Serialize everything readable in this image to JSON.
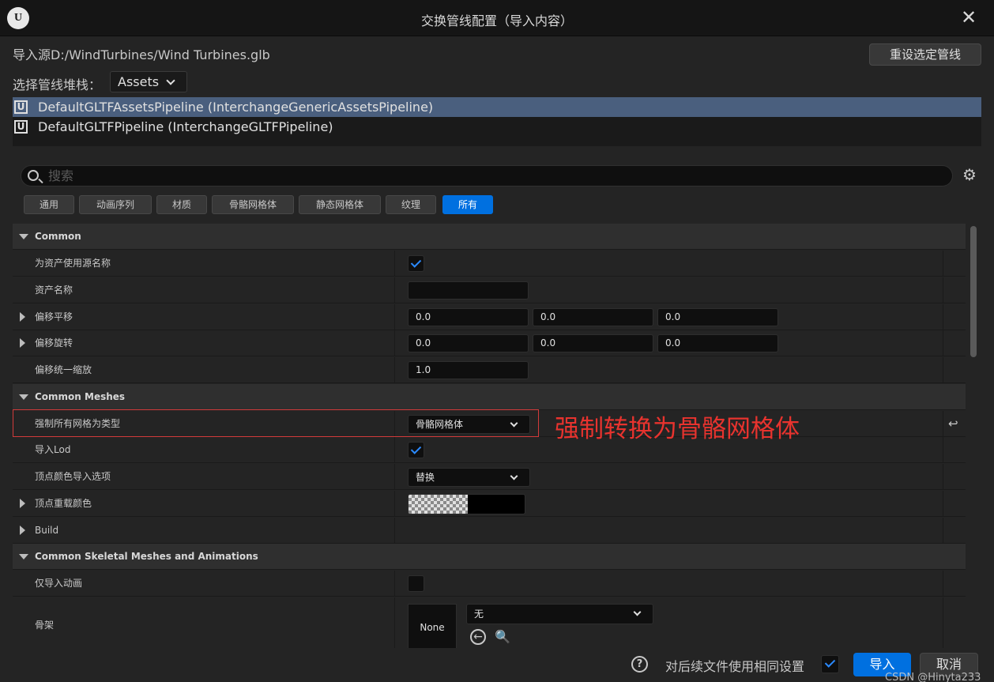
{
  "window": {
    "title": "交换管线配置（导入内容）",
    "logo_text": "U",
    "close_glyph": "✕"
  },
  "source": {
    "label": "导入源D:/WindTurbines/Wind Turbines.glb"
  },
  "reset_button": "重设选定管线",
  "stack": {
    "label": "选择管线堆栈：",
    "value": "Assets"
  },
  "pipelines": [
    {
      "label": "DefaultGLTFAssetsPipeline (InterchangeGenericAssetsPipeline)",
      "selected": true,
      "icon": "unreal-icon"
    },
    {
      "label": "DefaultGLTFPipeline (InterchangeGLTFPipeline)",
      "selected": false,
      "icon": "unreal-icon"
    }
  ],
  "search": {
    "placeholder": "搜索"
  },
  "filters": [
    "通用",
    "动画序列",
    "材质",
    "骨骼网格体",
    "静态网格体",
    "纹理",
    "所有"
  ],
  "active_filter": "所有",
  "details": {
    "common": {
      "header": "Common",
      "use_source_name": "为资产使用源名称",
      "asset_name": "资产名称",
      "offset_translation": "偏移平移",
      "offset_translation_values": [
        "0.0",
        "0.0",
        "0.0"
      ],
      "offset_rotation": "偏移旋转",
      "offset_rotation_values": [
        "0.0",
        "0.0",
        "0.0"
      ],
      "offset_uniform_scale": "偏移统一缩放",
      "offset_uniform_scale_value": "1.0"
    },
    "common_meshes": {
      "header": "Common Meshes",
      "force_mesh_type": "强制所有网格为类型",
      "force_mesh_type_value": "骨骼网格体",
      "import_lod": "导入Lod",
      "vertex_color_option": "顶点颜色导入选项",
      "vertex_color_option_value": "替换",
      "vertex_override_color": "顶点重载颜色",
      "build": "Build"
    },
    "common_skeletal": {
      "header": "Common Skeletal Meshes and Animations",
      "import_only_animations": "仅导入动画",
      "skeleton": "骨架",
      "skeleton_thumb": "None",
      "skeleton_value": "无"
    }
  },
  "annotation": "强制转换为骨骼网格体",
  "footer": {
    "same_settings": "对后续文件使用相同设置",
    "import": "导入",
    "cancel": "取消",
    "watermark": "CSDN @Hinyta233"
  },
  "colors": {
    "accent": "#0070e0",
    "selection": "#4a5f7e",
    "annotation": "#e8332e"
  }
}
